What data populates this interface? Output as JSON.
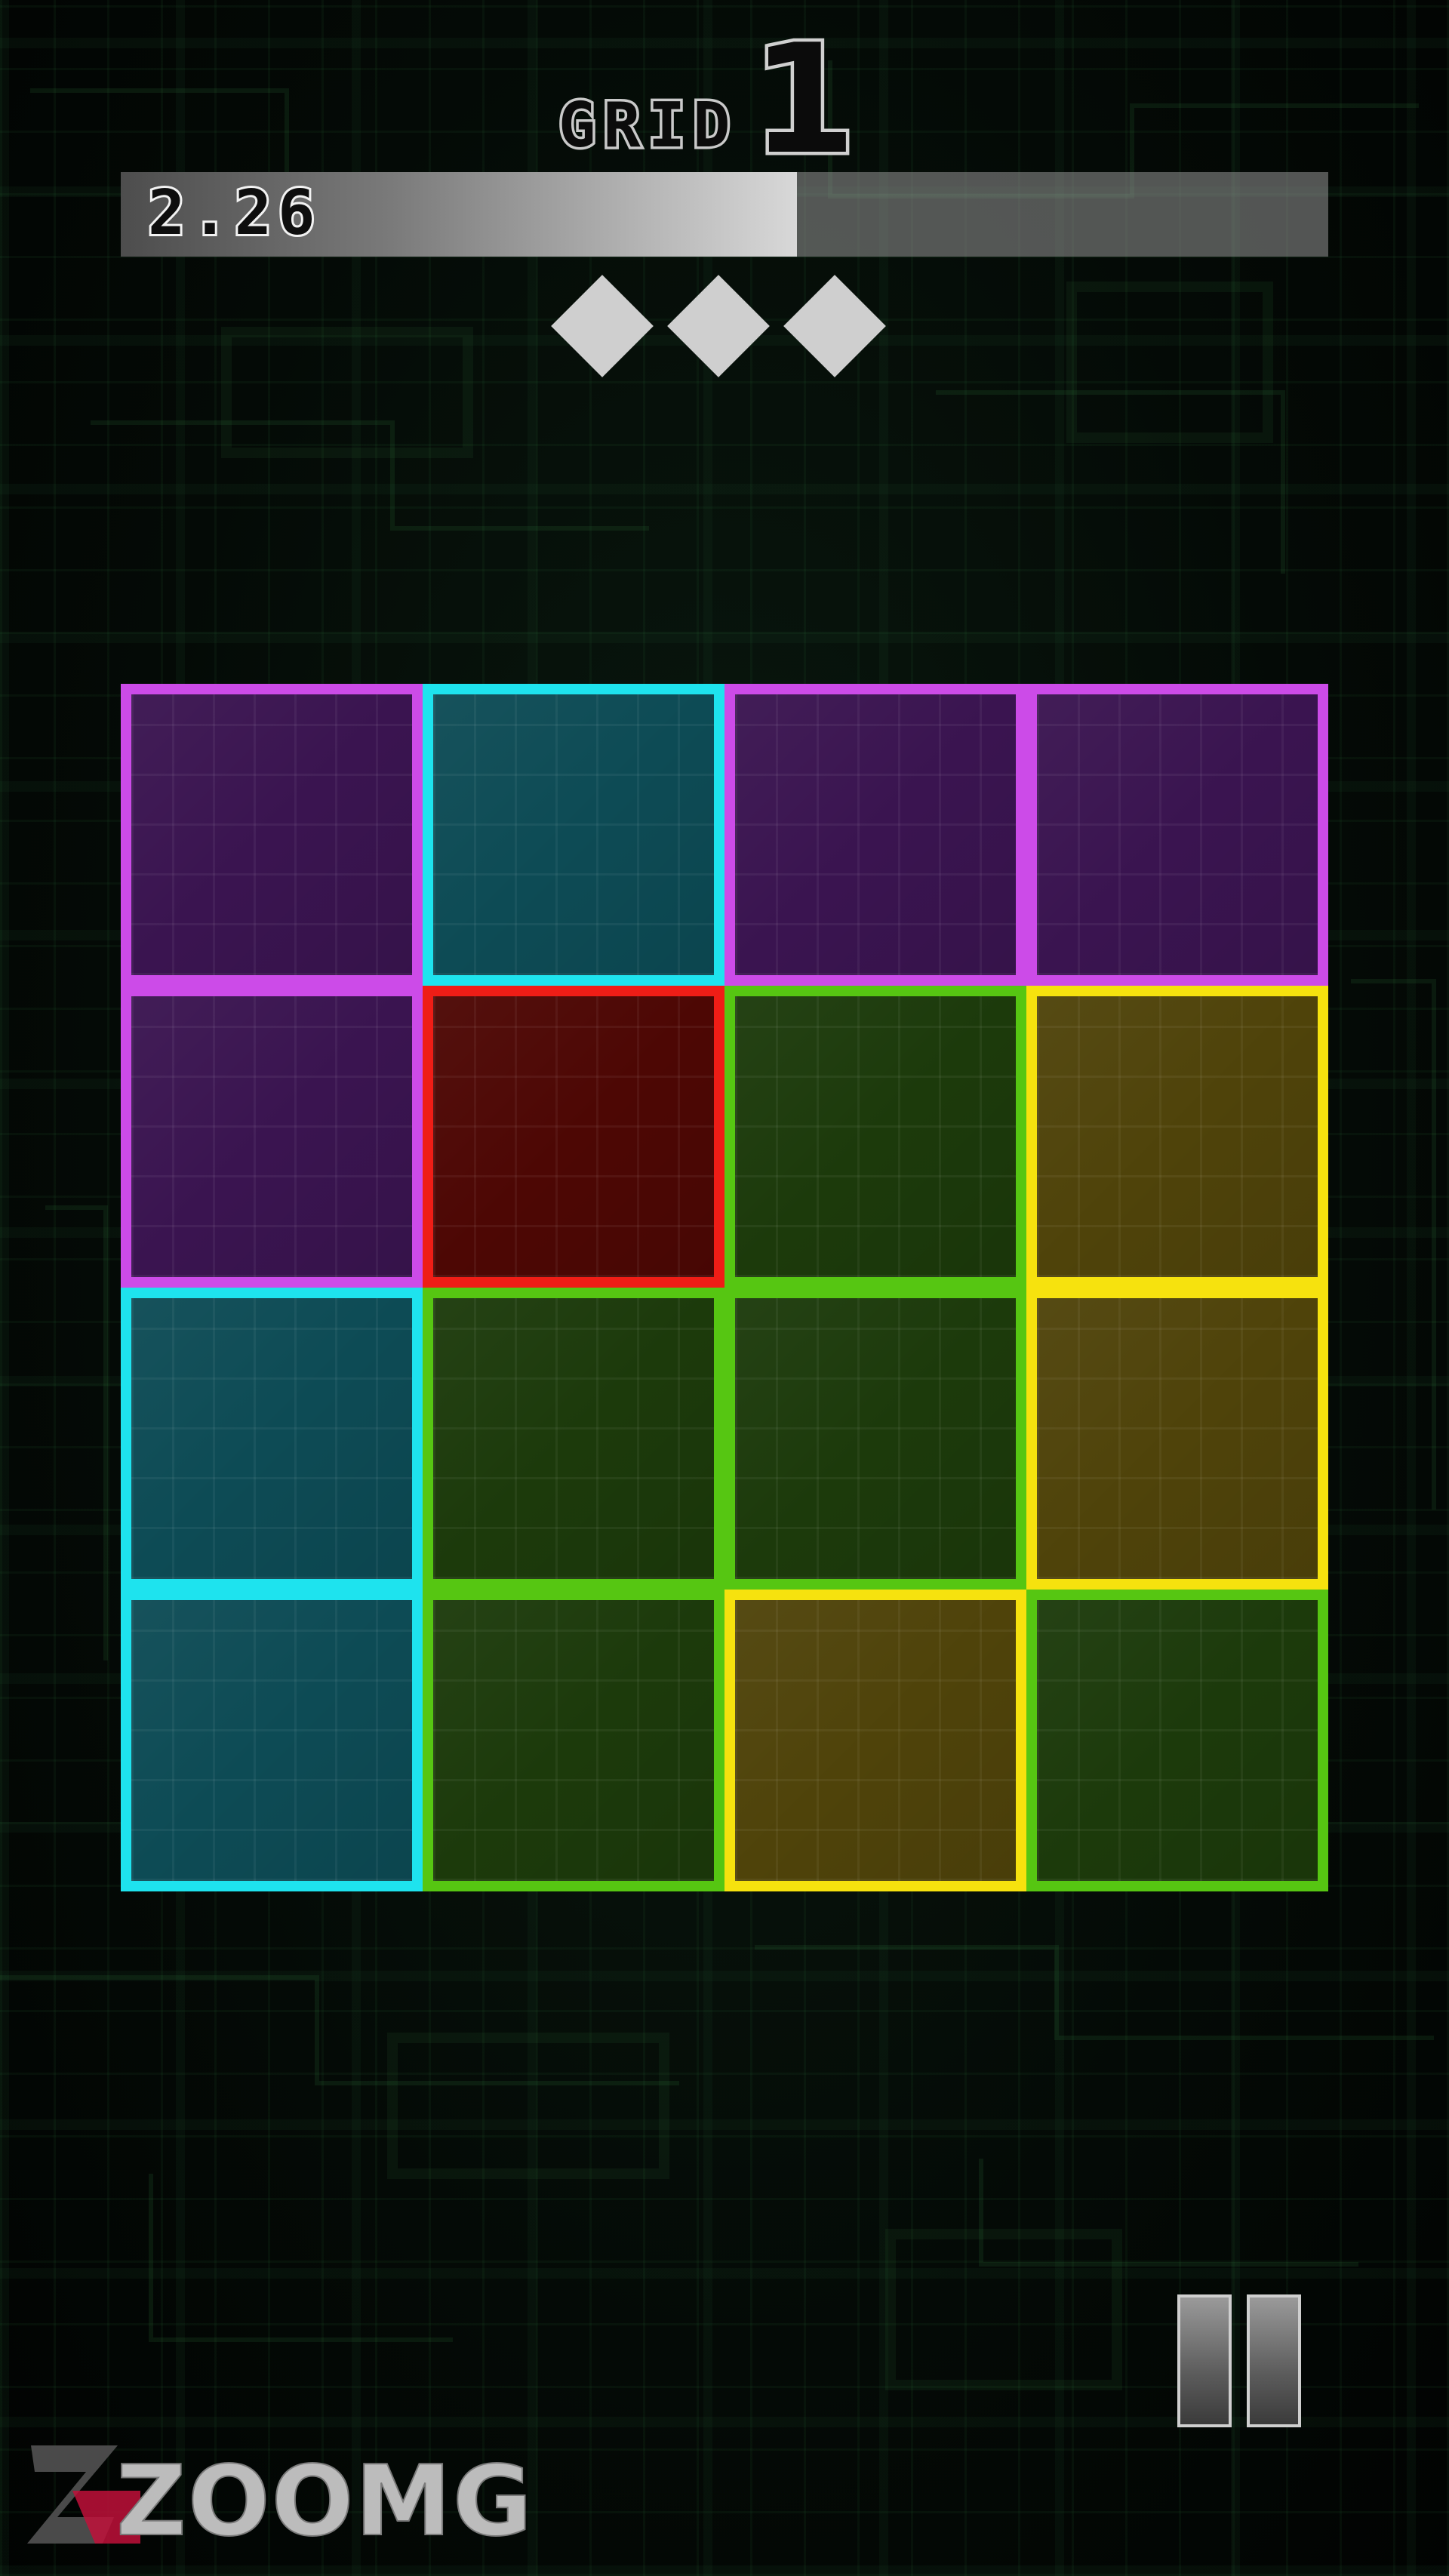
{
  "header": {
    "grid_label": "GRID",
    "grid_number": "1"
  },
  "timer": {
    "value_text": "2.26",
    "remaining_fraction": 0.56
  },
  "lives": {
    "count": 3,
    "icon": "diamond-icon"
  },
  "board": {
    "rows": 4,
    "cols": 4,
    "tiles": [
      [
        "purple",
        "cyan",
        "purple",
        "purple"
      ],
      [
        "purple",
        "red",
        "green",
        "yellow"
      ],
      [
        "cyan",
        "green",
        "green",
        "yellow"
      ],
      [
        "cyan",
        "green",
        "yellow",
        "green"
      ]
    ]
  },
  "colors": {
    "purple": "#cc4be8",
    "cyan": "#1ee3ee",
    "red": "#ef1d16",
    "green": "#56c612",
    "yellow": "#f6e20e"
  },
  "controls": {
    "pause_icon": "pause-icon"
  },
  "watermark": {
    "text": "ZOOMG"
  }
}
